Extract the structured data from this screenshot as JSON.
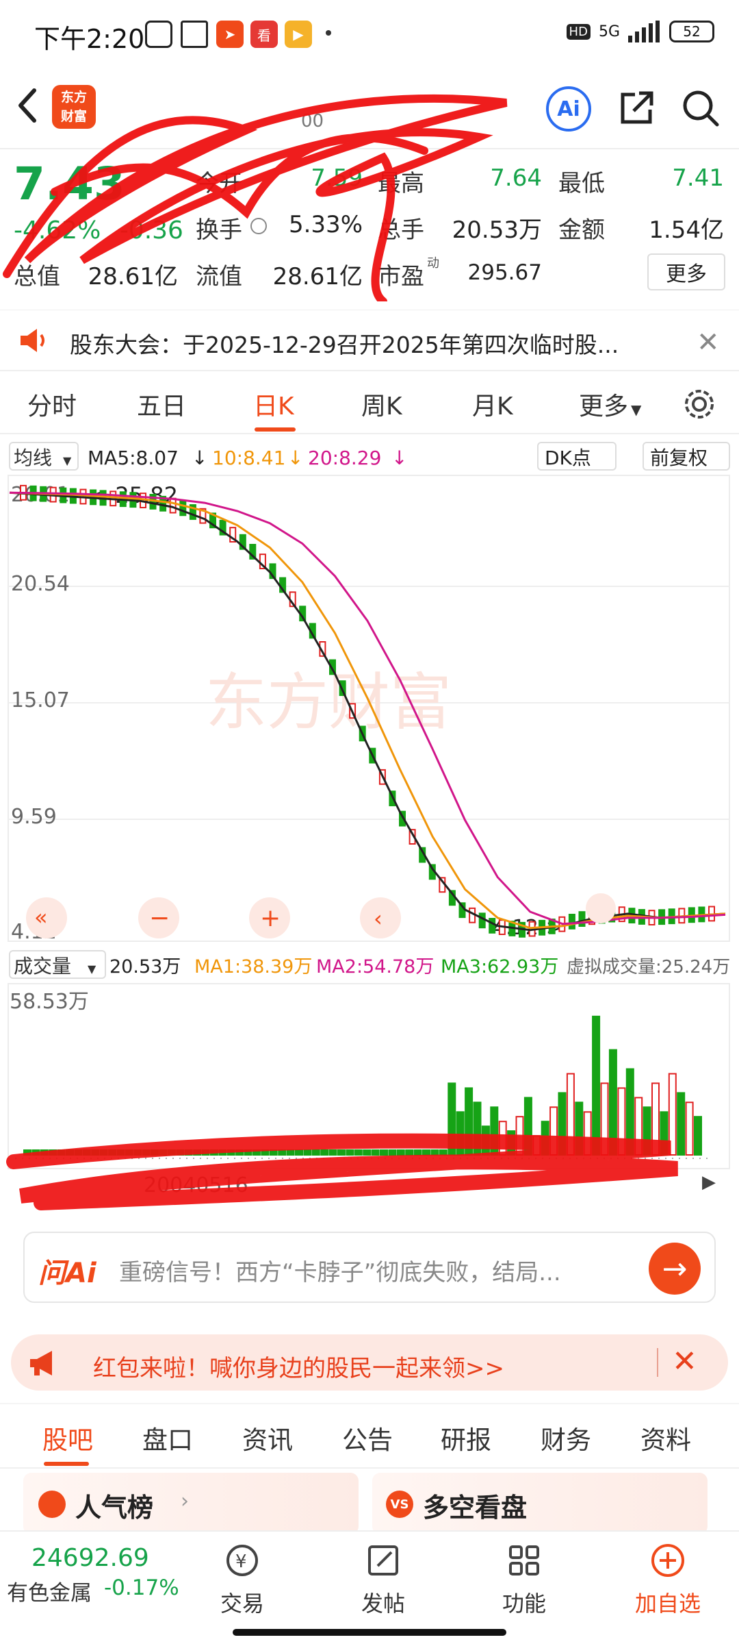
{
  "status_bar": {
    "time": "下午2:20",
    "battery": "52",
    "network": "5G"
  },
  "header": {
    "logo_text_line1": "东方",
    "logo_text_line2": "财富",
    "stock_code": "00",
    "ai_label": "Ai"
  },
  "quote": {
    "price": "7.43",
    "change_pct": "-4.62%",
    "change_abs": "-0.36",
    "open_label": "今开",
    "open": "7.59",
    "high_label": "最高",
    "high": "7.64",
    "low_label": "最低",
    "low": "7.41",
    "turnover_label": "换手",
    "turnover": "5.33%",
    "volume_label": "总手",
    "volume": "20.53万",
    "amount_label": "金额",
    "amount": "1.54亿",
    "mktcap_label": "总值",
    "mktcap": "28.61亿",
    "float_label": "流值",
    "float_cap": "28.61亿",
    "pe_label": "市盈",
    "pe_sup": "动",
    "pe": "295.67",
    "more_label": "更多"
  },
  "notice": {
    "text": "股东大会：于2025-12-29召开2025年第四次临时股..."
  },
  "chart_tabs": [
    {
      "label": "分时"
    },
    {
      "label": "五日"
    },
    {
      "label": "日K"
    },
    {
      "label": "周K"
    },
    {
      "label": "月K"
    },
    {
      "label": "更多"
    }
  ],
  "chart_toolbar": {
    "ma_selector": "均线",
    "ma5": "MA5:8.07",
    "ma10": "10:8.41",
    "ma20": "20:8.29",
    "dk_label": "DK点",
    "adjust_label": "前复权",
    "vol_selector": "成交量",
    "vol_value": "20.53万",
    "vol_ma1": "MA1:38.39万",
    "vol_ma2": "MA2:54.78万",
    "vol_ma3": "MA3:62.93万",
    "virtual_vol": "虚拟成交量:25.24万",
    "vol_max": "58.53万",
    "date_label": "20040516",
    "max_marker": "<-25.82",
    "min_marker": "4.12->"
  },
  "chart_data": {
    "type": "candlestick",
    "y_ticks": [
      "26.01",
      "20.54",
      "15.07",
      "9.59",
      "4.12"
    ],
    "ylim": [
      4.12,
      26.01
    ],
    "series": [
      {
        "name": "MA5",
        "values": [
          25.9,
          25.8,
          25.7,
          25.6,
          25.5,
          25.2,
          24.6,
          23.5,
          22.0,
          19.8,
          17.0,
          13.5,
          10.2,
          7.4,
          5.4,
          4.6,
          4.4,
          4.6,
          5.0,
          5.2,
          5.0,
          5.1,
          5.2
        ]
      },
      {
        "name": "10",
        "values": [
          25.9,
          25.85,
          25.8,
          25.7,
          25.6,
          25.4,
          25.0,
          24.3,
          23.2,
          21.5,
          19.0,
          15.8,
          12.3,
          9.0,
          6.4,
          5.0,
          4.5,
          4.6,
          4.9,
          5.1,
          5.0,
          5.1,
          5.2
        ]
      },
      {
        "name": "20",
        "values": [
          25.9,
          25.88,
          25.85,
          25.8,
          25.7,
          25.6,
          25.4,
          25.0,
          24.4,
          23.4,
          21.8,
          19.6,
          16.7,
          13.3,
          9.8,
          7.0,
          5.3,
          4.7,
          4.8,
          5.0,
          5.0,
          5.05,
          5.15
        ]
      }
    ],
    "volume_max": 58.53,
    "colors": {
      "ma5": "#222222",
      "ma10": "#f0960a",
      "ma20": "#d1168a",
      "up": "#e02020",
      "down": "#16a316"
    }
  },
  "ai_bar": {
    "logo": "问Ai",
    "text": "重磅信号！西方“卡脖子”彻底失败，结局..."
  },
  "promo": {
    "text": "红包来啦！喊你身边的股民一起来领>>"
  },
  "content_tabs": [
    {
      "label": "股吧"
    },
    {
      "label": "盘口"
    },
    {
      "label": "资讯"
    },
    {
      "label": "公告"
    },
    {
      "label": "研报"
    },
    {
      "label": "财务"
    },
    {
      "label": "资料"
    }
  ],
  "cards": {
    "popular": "人气榜",
    "longshort": "多空看盘"
  },
  "bottom_nav": {
    "index_value": "24692.69",
    "index_name": "有色金属",
    "index_change": "-0.17%",
    "items": [
      {
        "label": "交易"
      },
      {
        "label": "发帖"
      },
      {
        "label": "功能"
      },
      {
        "label": "加自选"
      }
    ]
  }
}
